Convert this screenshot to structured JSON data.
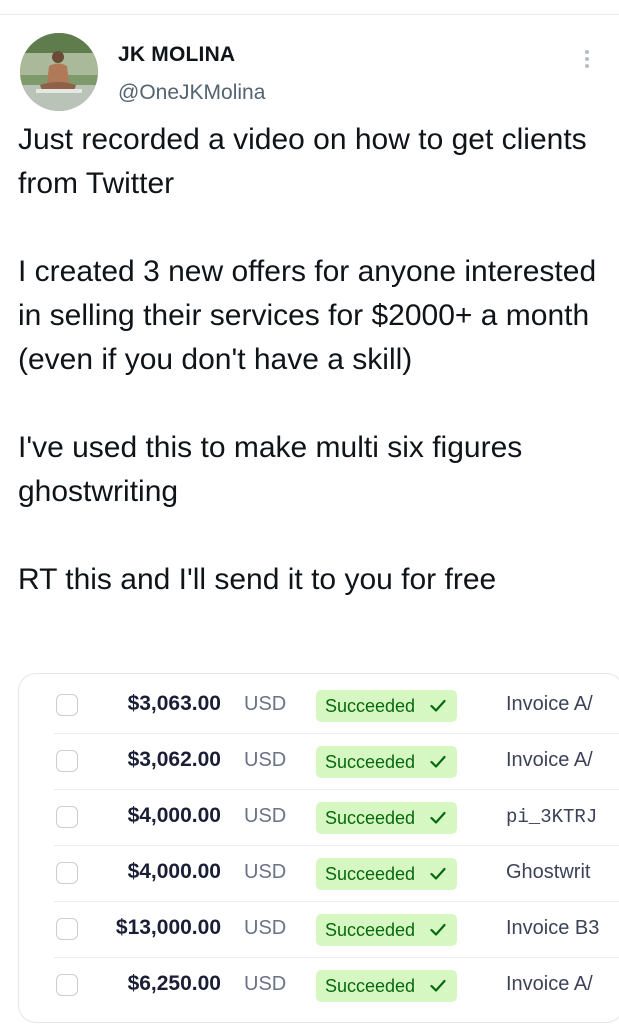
{
  "author": {
    "name": "JK MOLINA",
    "handle": "@OneJKMolina"
  },
  "tweet": {
    "paragraphs": [
      "Just recorded a video on how to get clients from Twitter",
      "I created 3 new offers for anyone interested in selling their services for $2000+ a month (even if you don't have a skill)",
      "I've used this to make multi six figures ghostwriting",
      "RT this and I'll send it to you for free"
    ]
  },
  "payments": {
    "rows": [
      {
        "amount": "$3,063.00",
        "currency": "USD",
        "status": "Succeeded",
        "description": "Invoice A/"
      },
      {
        "amount": "$3,062.00",
        "currency": "USD",
        "status": "Succeeded",
        "description": "Invoice A/"
      },
      {
        "amount": "$4,000.00",
        "currency": "USD",
        "status": "Succeeded",
        "description": "pi_3KTRJ"
      },
      {
        "amount": "$4,000.00",
        "currency": "USD",
        "status": "Succeeded",
        "description": "Ghostwrit"
      },
      {
        "amount": "$13,000.00",
        "currency": "USD",
        "status": "Succeeded",
        "description": "Invoice B3"
      },
      {
        "amount": "$6,250.00",
        "currency": "USD",
        "status": "Succeeded",
        "description": "Invoice A/"
      }
    ]
  },
  "icons": {
    "more": "more-vertical-icon",
    "status": "checkmark-icon"
  },
  "colors": {
    "status_bg": "#d7f7c2",
    "status_text": "#05690d"
  }
}
